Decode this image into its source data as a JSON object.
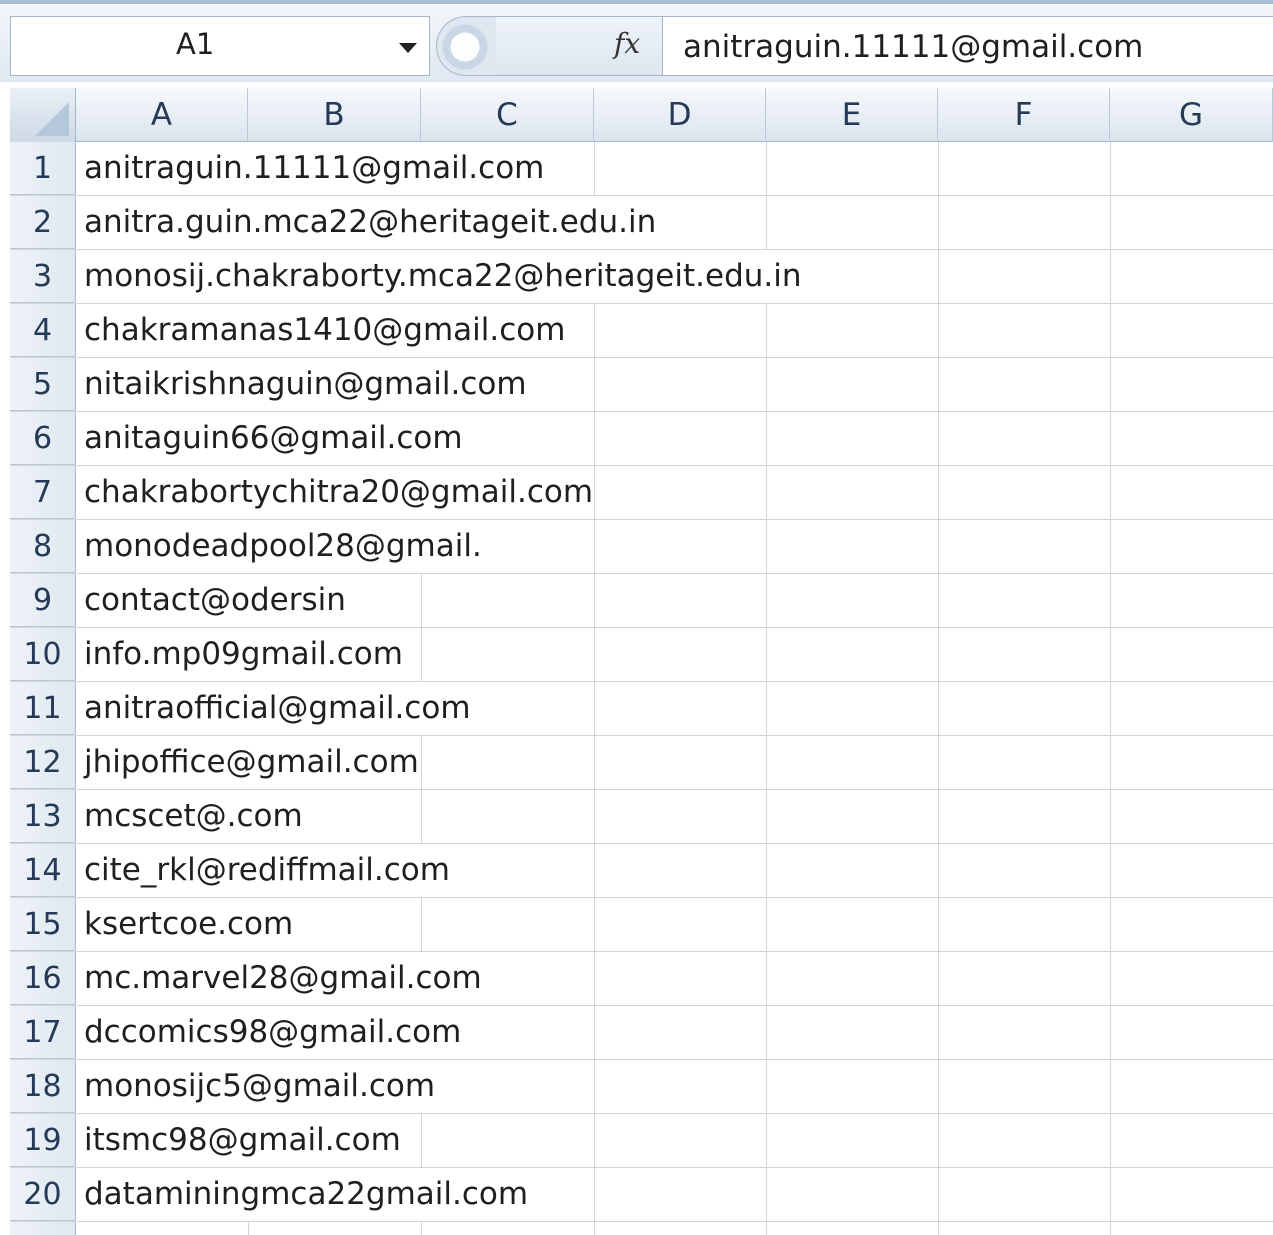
{
  "formula_bar": {
    "name_box": "A1",
    "fx_symbol": "fx",
    "formula_value": "anitraguin.11111@gmail.com"
  },
  "columns": [
    "A",
    "B",
    "C",
    "D",
    "E",
    "F",
    "G"
  ],
  "rows": [
    {
      "num": "1",
      "a": "anitraguin.11111@gmail.com"
    },
    {
      "num": "2",
      "a": "anitra.guin.mca22@heritageit.edu.in"
    },
    {
      "num": "3",
      "a": "monosij.chakraborty.mca22@heritageit.edu.in"
    },
    {
      "num": "4",
      "a": "chakramanas1410@gmail.com"
    },
    {
      "num": "5",
      "a": "nitaikrishnaguin@gmail.com"
    },
    {
      "num": "6",
      "a": "anitaguin66@gmail.com"
    },
    {
      "num": "7",
      "a": "chakrabortychitra20@gmail.com"
    },
    {
      "num": "8",
      "a": "monodeadpool28@gmail."
    },
    {
      "num": "9",
      "a": "contact@odersin"
    },
    {
      "num": "10",
      "a": "info.mp09gmail.com"
    },
    {
      "num": "11",
      "a": "anitraofficial@gmail.com"
    },
    {
      "num": "12",
      "a": "jhipoffice@gmail.com"
    },
    {
      "num": "13",
      "a": "mcscet@.com"
    },
    {
      "num": "14",
      "a": "cite_rkl@rediffmail.com"
    },
    {
      "num": "15",
      "a": "ksertcoe.com"
    },
    {
      "num": "16",
      "a": "mc.marvel28@gmail.com"
    },
    {
      "num": "17",
      "a": "dccomics98@gmail.com"
    },
    {
      "num": "18",
      "a": "monosijc5@gmail.com"
    },
    {
      "num": "19",
      "a": "itsmc98@gmail.com"
    },
    {
      "num": "20",
      "a": "dataminingmca22gmail.com"
    }
  ]
}
